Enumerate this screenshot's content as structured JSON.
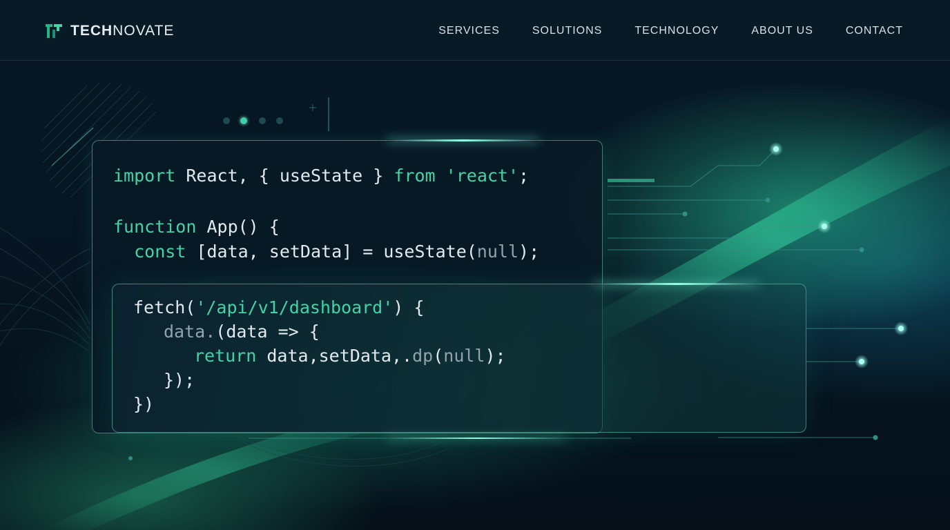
{
  "brand": {
    "name_bold": "TECH",
    "name_light": "NOVATE",
    "icon": "logo-mark-icon"
  },
  "nav": {
    "items": [
      {
        "label": "SERVICES"
      },
      {
        "label": "SOLUTIONS"
      },
      {
        "label": "TECHNOLOGY"
      },
      {
        "label": "ABOUT US"
      },
      {
        "label": "CONTACT"
      }
    ]
  },
  "code_top": {
    "line1": {
      "t1": "import",
      "t2": " React, { useState } ",
      "t3": "from",
      "t4": " ",
      "t5": "'react'",
      "t6": ";"
    },
    "line2": {
      "t1": "function",
      "t2": " App() {"
    },
    "line3": {
      "t1": "  const",
      "t2": " [data, setData] = useState(",
      "t3": "null",
      "t4": ");"
    }
  },
  "code_bottom": {
    "line1": {
      "t1": "fetch(",
      "t2": "'/api/v1/dashboard'",
      "t3": ") {"
    },
    "line2": {
      "t1": "data.",
      "t2": "(data => {"
    },
    "line3": {
      "t1": "return",
      "t2": " data,setData,.",
      "t3": "dp",
      "t4": "(",
      "t5": "null",
      "t6": ");"
    },
    "line4": {
      "t1": "});"
    },
    "line5": {
      "t1": "})"
    }
  },
  "colors": {
    "background": "#06141f",
    "accent": "#43d3a5",
    "header": "#071a26",
    "text": "#e3eaee"
  }
}
